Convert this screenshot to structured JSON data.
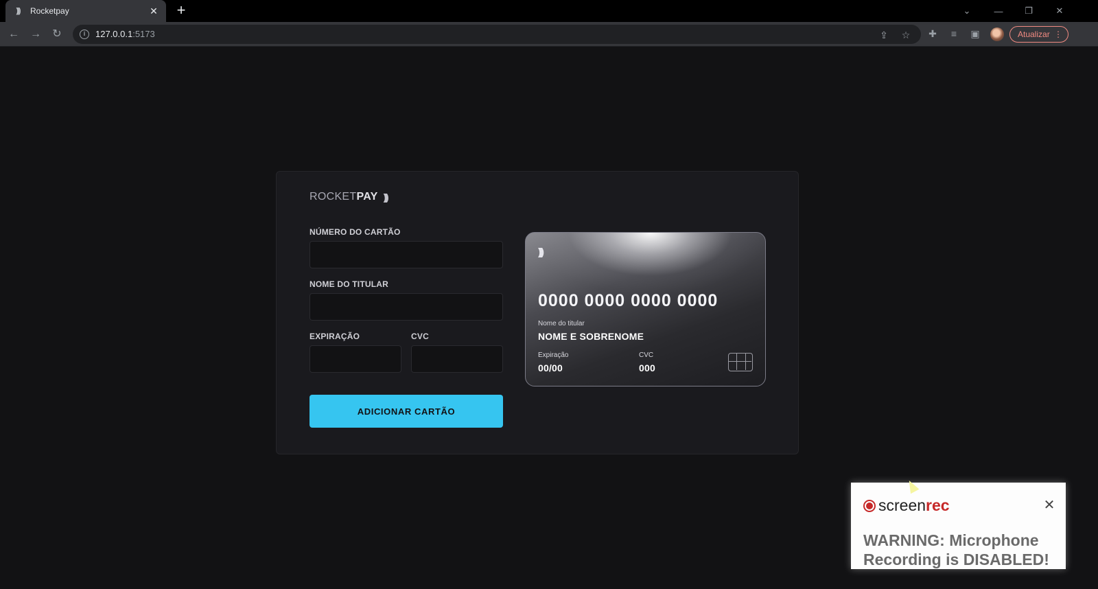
{
  "browser": {
    "tab_title": "Rocketpay",
    "tab_close": "✕",
    "new_tab": "+",
    "favicon": ")))",
    "url_host": "127.0.0.1",
    "url_port": ":5173",
    "update_label": "Atualizar",
    "icons": [
      "back-icon",
      "forward-icon",
      "reload-icon",
      "info-icon",
      "share-icon",
      "star-icon",
      "extensions-icon",
      "media-icon",
      "side-panel-icon",
      "menu-icon"
    ]
  },
  "form": {
    "logo_light": "ROCKET",
    "logo_bold": "PAY",
    "logo_signal": ")))",
    "card_number_label": "NÚMERO DO CARTÃO",
    "card_number_value": "",
    "holder_label": "NOME DO TITULAR",
    "holder_value": "",
    "expiry_label": "EXPIRAÇÃO",
    "expiry_value": "",
    "cvc_label": "CVC",
    "cvc_value": "",
    "submit_label": "ADICIONAR CARTÃO"
  },
  "card": {
    "signal": ")))",
    "number": "0000 0000 0000 0000",
    "holder_caption": "Nome do titular",
    "holder_name": "NOME E SOBRENOME",
    "expiry_caption": "Expiração",
    "expiry_value": "00/00",
    "cvc_caption": "CVC",
    "cvc_value": "000"
  },
  "screenrec": {
    "brand_light": "screen",
    "brand_bold": "rec",
    "close": "✕",
    "warning": "WARNING: Microphone Recording is DISABLED!"
  },
  "colors": {
    "page_bg": "#121214",
    "accent": "#36c5f0",
    "panel": "#1a1a1e",
    "update_red": "#f28b82",
    "rec_red": "#c62828"
  }
}
